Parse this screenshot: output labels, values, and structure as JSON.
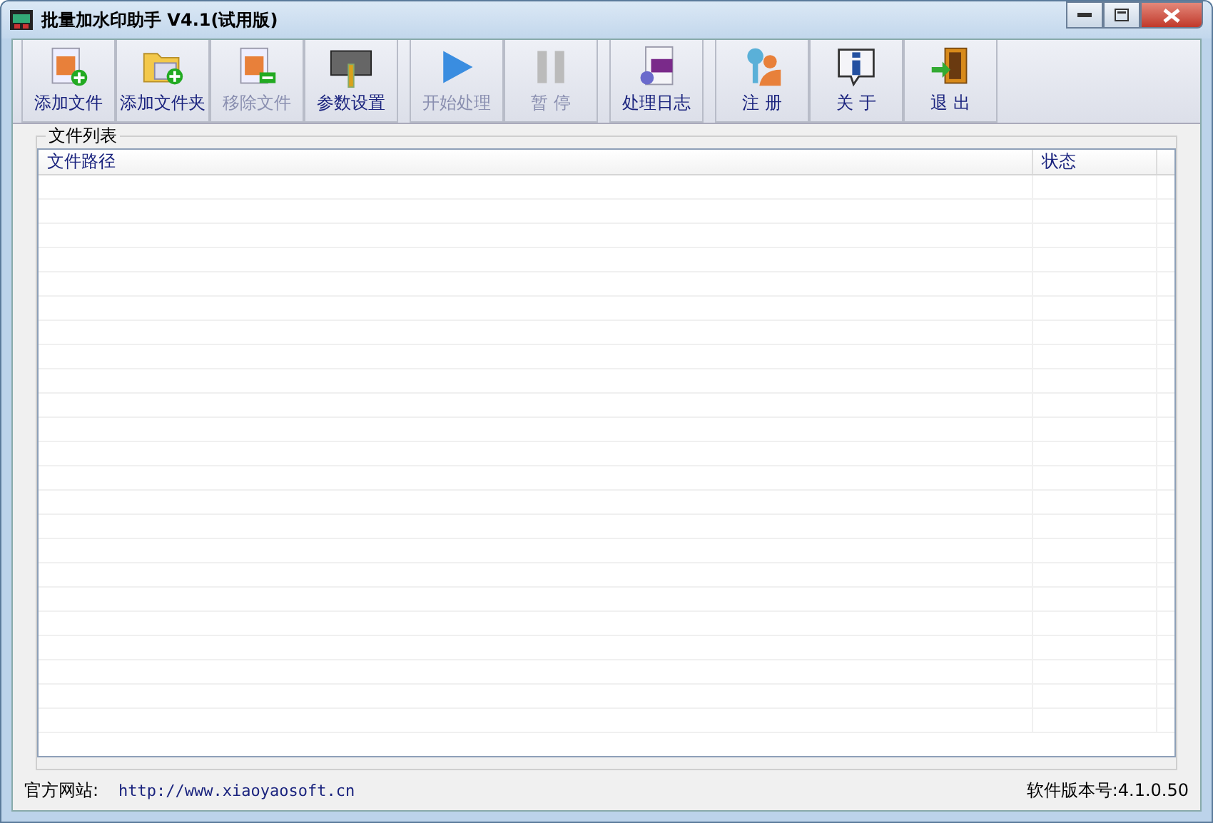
{
  "window": {
    "title": "批量加水印助手 V4.1(试用版)"
  },
  "toolbar": [
    {
      "buttons": [
        {
          "label": "添加文件",
          "kind": "add-file",
          "disabled": false
        },
        {
          "label": "添加文件夹",
          "kind": "add-folder",
          "disabled": false
        },
        {
          "label": "移除文件",
          "kind": "remove-file",
          "disabled": true
        },
        {
          "label": "参数设置",
          "kind": "settings",
          "disabled": false
        }
      ]
    },
    {
      "buttons": [
        {
          "label": "开始处理",
          "kind": "play",
          "disabled": true
        },
        {
          "label": "暂 停",
          "kind": "pause",
          "disabled": true
        }
      ]
    },
    {
      "buttons": [
        {
          "label": "处理日志",
          "kind": "log",
          "disabled": false
        }
      ]
    },
    {
      "buttons": [
        {
          "label": "注 册",
          "kind": "key",
          "disabled": false
        },
        {
          "label": "关 于",
          "kind": "info",
          "disabled": false
        },
        {
          "label": "退 出",
          "kind": "exit",
          "disabled": false
        }
      ]
    }
  ],
  "file_list": {
    "title": "文件列表",
    "columns": [
      "文件路径",
      "状态"
    ]
  },
  "status_bar": {
    "website_label": "官方网站:",
    "website_url": "http://www.xiaoyaosoft.cn",
    "version": "软件版本号:4.1.0.50"
  }
}
